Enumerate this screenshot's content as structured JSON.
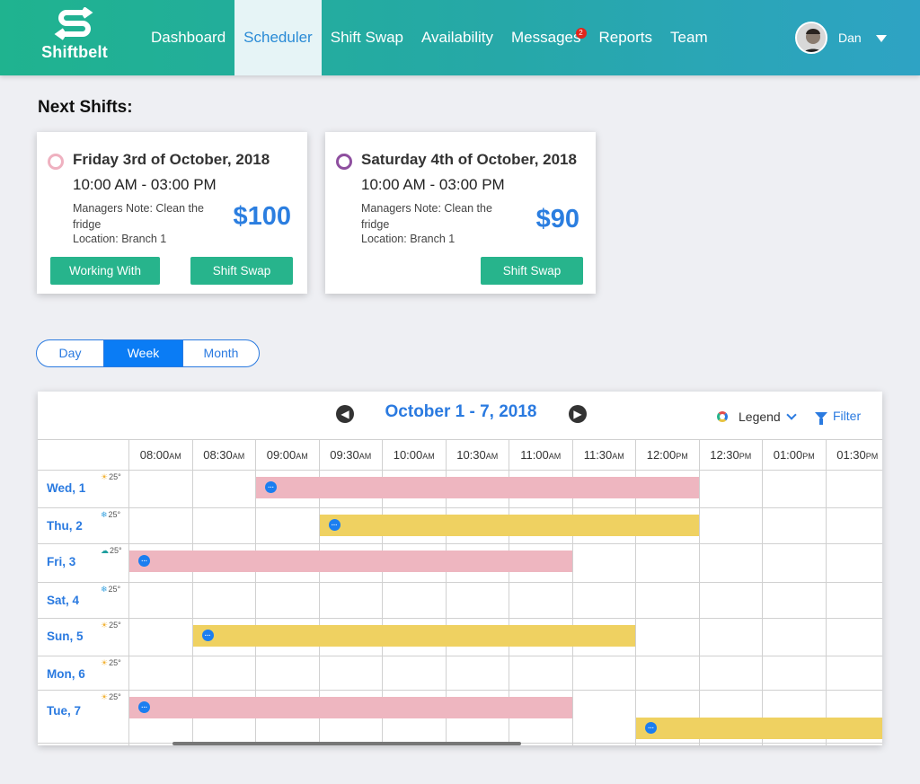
{
  "header": {
    "brand": "Shiftbelt",
    "nav": [
      {
        "label": "Dashboard",
        "active": false
      },
      {
        "label": "Scheduler",
        "active": true
      },
      {
        "label": "Shift Swap",
        "active": false
      },
      {
        "label": "Availability",
        "active": false
      },
      {
        "label": "Messages",
        "active": false,
        "badge": "2"
      },
      {
        "label": "Reports",
        "active": false
      },
      {
        "label": "Team",
        "active": false
      }
    ],
    "user": {
      "name": "Dan"
    }
  },
  "next_shifts": {
    "title": "Next Shifts:",
    "cards": [
      {
        "date": "Friday 3rd of October, 2018",
        "time": "10:00 AM - 03:00 PM",
        "note": "Managers Note: Clean the fridge",
        "location": "Location: Branch 1",
        "price": "$100",
        "ring_color": "#efb1c0",
        "buttons": [
          "Working With",
          "Shift Swap"
        ]
      },
      {
        "date": "Saturday 4th of October, 2018",
        "time": "10:00 AM - 03:00 PM",
        "note": "Managers Note: Clean the fridge",
        "location": "Location: Branch 1",
        "price": "$90",
        "ring_color": "#8e4f9f",
        "buttons": [
          "Shift Swap"
        ]
      }
    ]
  },
  "view_toggle": {
    "options": [
      "Day",
      "Week",
      "Month"
    ],
    "selected": "Week"
  },
  "scheduler": {
    "range_title": "October 1 - 7, 2018",
    "legend_label": "Legend",
    "filter_label": "Filter",
    "times": [
      {
        "t": "08:00",
        "p": "AM"
      },
      {
        "t": "08:30",
        "p": "AM"
      },
      {
        "t": "09:00",
        "p": "AM"
      },
      {
        "t": "09:30",
        "p": "AM"
      },
      {
        "t": "10:00",
        "p": "AM"
      },
      {
        "t": "10:30",
        "p": "AM"
      },
      {
        "t": "11:00",
        "p": "AM"
      },
      {
        "t": "11:30",
        "p": "AM"
      },
      {
        "t": "12:00",
        "p": "PM"
      },
      {
        "t": "12:30",
        "p": "PM"
      },
      {
        "t": "01:00",
        "p": "PM"
      },
      {
        "t": "01:30",
        "p": "PM"
      }
    ],
    "days": [
      {
        "label": "Wed, 1",
        "weather_icon": "sun-icon",
        "temp": "25°"
      },
      {
        "label": "Thu, 2",
        "weather_icon": "snow-icon",
        "temp": "25°"
      },
      {
        "label": "Fri, 3",
        "weather_icon": "cloud-icon",
        "temp": "25°"
      },
      {
        "label": "Sat, 4",
        "weather_icon": "snow-icon",
        "temp": "25°"
      },
      {
        "label": "Sun, 5",
        "weather_icon": "sun-icon",
        "temp": "25°"
      },
      {
        "label": "Mon, 6",
        "weather_icon": "sun-icon",
        "temp": "25°"
      },
      {
        "label": "Tue, 7",
        "weather_icon": "sun-icon",
        "temp": "25°"
      }
    ],
    "shifts": [
      {
        "day": 0,
        "start": "09:00",
        "end": "12:30",
        "color": "pink"
      },
      {
        "day": 1,
        "start": "09:30",
        "end": "12:30",
        "color": "yellow"
      },
      {
        "day": 2,
        "start": "08:00",
        "end": "11:30",
        "color": "pink"
      },
      {
        "day": 4,
        "start": "08:30",
        "end": "12:00",
        "color": "yellow"
      },
      {
        "day": 6,
        "start": "08:00",
        "end": "11:30",
        "color": "pink"
      },
      {
        "day": 6,
        "start": "12:00",
        "end": "14:00",
        "color": "yellow"
      }
    ],
    "colors": {
      "pink": "#eeb6c0",
      "yellow": "#efd161",
      "accent": "#2a7ae0",
      "green": "#27b48c"
    }
  }
}
